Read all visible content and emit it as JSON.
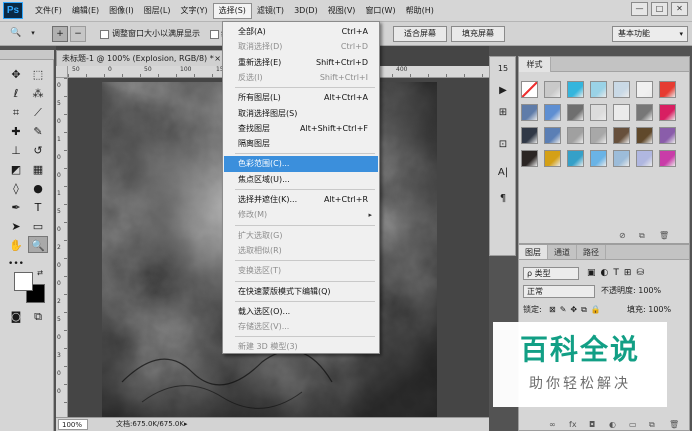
{
  "app": {
    "logo": "Ps"
  },
  "menubar": {
    "items": [
      "文件(F)",
      "编辑(E)",
      "图像(I)",
      "图层(L)",
      "文字(Y)",
      "选择(S)",
      "滤镜(T)",
      "3D(D)",
      "视图(V)",
      "窗口(W)",
      "帮助(H)"
    ],
    "active_index": 5
  },
  "window_controls": {
    "minimize": "—",
    "maximize": "□",
    "close": "✕"
  },
  "options_bar": {
    "tool_glyph": "🔍",
    "zoom_in": "+",
    "zoom_out": "−",
    "checkbox_label": "调整窗口大小以满屏显示",
    "checkbox2_label": "缩",
    "fit_screen": "适合屏幕",
    "fill_screen": "填充屏幕",
    "workspace": "基本功能"
  },
  "document": {
    "tab_title": "未标题-1 @ 100% (Explosion, RGB/8) *",
    "tab_close": "×",
    "zoom": "100%",
    "doc_size": "文档:675.0K/675.0K",
    "status_arrow": "▸"
  },
  "ruler": {
    "top_labels": [
      "50",
      "0",
      "50",
      "100",
      "150",
      "200",
      "250",
      "300",
      "350",
      "400"
    ],
    "left_labels": [
      "0",
      "5",
      "0",
      "1",
      "0",
      "0",
      "1",
      "5",
      "0",
      "2",
      "0",
      "0",
      "2",
      "5",
      "0",
      "3",
      "0",
      "0"
    ]
  },
  "select_menu": {
    "items": [
      {
        "label": "全部(A)",
        "shortcut": "Ctrl+A",
        "disabled": false
      },
      {
        "label": "取消选择(D)",
        "shortcut": "Ctrl+D",
        "disabled": true
      },
      {
        "label": "重新选择(E)",
        "shortcut": "Shift+Ctrl+D",
        "disabled": false
      },
      {
        "label": "反选(I)",
        "shortcut": "Shift+Ctrl+I",
        "disabled": true
      },
      {
        "separator": true
      },
      {
        "label": "所有图层(L)",
        "shortcut": "Alt+Ctrl+A",
        "disabled": false
      },
      {
        "label": "取消选择图层(S)",
        "shortcut": "",
        "disabled": false
      },
      {
        "label": "查找图层",
        "shortcut": "Alt+Shift+Ctrl+F",
        "disabled": false
      },
      {
        "label": "隔离图层",
        "shortcut": "",
        "disabled": false
      },
      {
        "separator": true
      },
      {
        "label": "色彩范围(C)...",
        "shortcut": "",
        "disabled": false,
        "highlighted": true
      },
      {
        "label": "焦点区域(U)...",
        "shortcut": "",
        "disabled": false
      },
      {
        "separator": true
      },
      {
        "label": "选择并遮住(K)...",
        "shortcut": "Alt+Ctrl+R",
        "disabled": false
      },
      {
        "label": "修改(M)",
        "shortcut": "",
        "disabled": true,
        "submenu": true
      },
      {
        "separator": true
      },
      {
        "label": "扩大选取(G)",
        "shortcut": "",
        "disabled": true
      },
      {
        "label": "选取相似(R)",
        "shortcut": "",
        "disabled": true
      },
      {
        "separator": true
      },
      {
        "label": "变换选区(T)",
        "shortcut": "",
        "disabled": true
      },
      {
        "separator": true
      },
      {
        "label": "在快速蒙版模式下编辑(Q)",
        "shortcut": "",
        "disabled": false
      },
      {
        "separator": true
      },
      {
        "label": "载入选区(O)...",
        "shortcut": "",
        "disabled": false
      },
      {
        "label": "存储选区(V)...",
        "shortcut": "",
        "disabled": true
      },
      {
        "separator": true
      },
      {
        "label": "新建 3D 模型(3)",
        "shortcut": "",
        "disabled": true
      }
    ],
    "submenu_arrow": "▸"
  },
  "styles_panel": {
    "tab": "样式",
    "swatch_colors": [
      "none",
      "#c9c9c9",
      "#34b5dd",
      "#9ad2e6",
      "#c9d9e6",
      "#f0f0f0",
      "#e63c32",
      "#5f7ca9",
      "#5e8fd2",
      "#6f6f6f",
      "#dcdcdc",
      "#ebebeb",
      "#777777",
      "#d81f62",
      "#303846",
      "#5b7fb5",
      "#a0a0a0",
      "#a8a8a8",
      "#67503c",
      "#60492b",
      "#8a5daa",
      "#2b2624",
      "#d4a016",
      "#35a0c8",
      "#6ab3e5",
      "#9cbcd9",
      "#b0b7e0",
      "#c93ca8"
    ]
  },
  "layers_panel": {
    "tabs": [
      "图层",
      "通道",
      "路径"
    ],
    "filter_label": "ρ 类型",
    "blend_mode": "正常",
    "opacity_label": "不透明度: 100%",
    "lock_label": "锁定:",
    "fill_label": "填充: 100%"
  },
  "watermark": {
    "title": "百科全说",
    "subtitle": "助你轻松解决"
  }
}
